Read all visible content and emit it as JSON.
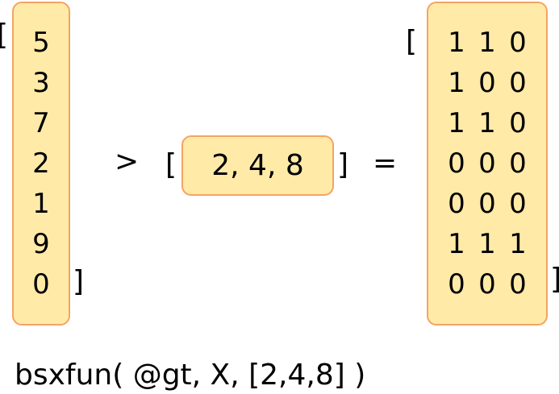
{
  "column_vector": {
    "values": [
      "5",
      "3",
      "7",
      "2",
      "1",
      "9",
      "0"
    ],
    "open_bracket": "[",
    "close_bracket": "]"
  },
  "operator": ">",
  "row_vector": {
    "text": "2, 4, 8",
    "open_bracket": "[",
    "close_bracket": "]"
  },
  "equals": "=",
  "result_matrix": {
    "rows": [
      [
        "1",
        "1",
        "0"
      ],
      [
        "1",
        "0",
        "0"
      ],
      [
        "1",
        "1",
        "0"
      ],
      [
        "0",
        "0",
        "0"
      ],
      [
        "0",
        "0",
        "0"
      ],
      [
        "1",
        "1",
        "1"
      ],
      [
        "0",
        "0",
        "0"
      ]
    ],
    "open_bracket": "[",
    "close_bracket": "]"
  },
  "caption": "bsxfun( @gt, X, [2,4,8] )",
  "colors": {
    "box_fill": "#ffeaa8",
    "box_border": "#f4a462"
  }
}
